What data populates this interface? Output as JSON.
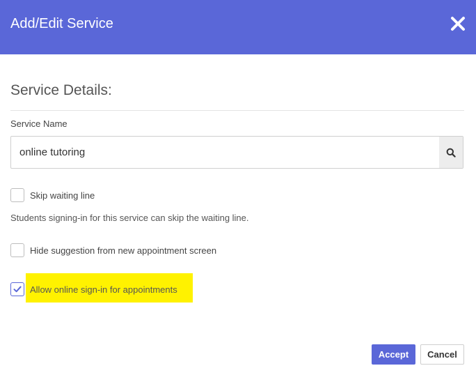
{
  "dialog": {
    "title": "Add/Edit Service",
    "close_icon": "close-icon",
    "header_color": "#5a67d8"
  },
  "details": {
    "section_title": "Service Details:",
    "service_name_label": "Service Name",
    "service_name_value": "online tutoring",
    "search_icon": "search-icon"
  },
  "options": {
    "skip_waiting": {
      "label": "Skip waiting line",
      "checked": false,
      "help": "Students signing-in for this service can skip the waiting line."
    },
    "hide_suggestion": {
      "label": "Hide suggestion from new appointment screen",
      "checked": false
    },
    "allow_online_signin": {
      "label": "Allow online sign-in for appointments",
      "checked": true,
      "highlight_color": "#fff200"
    }
  },
  "footer": {
    "accept_label": "Accept",
    "cancel_label": "Cancel"
  }
}
